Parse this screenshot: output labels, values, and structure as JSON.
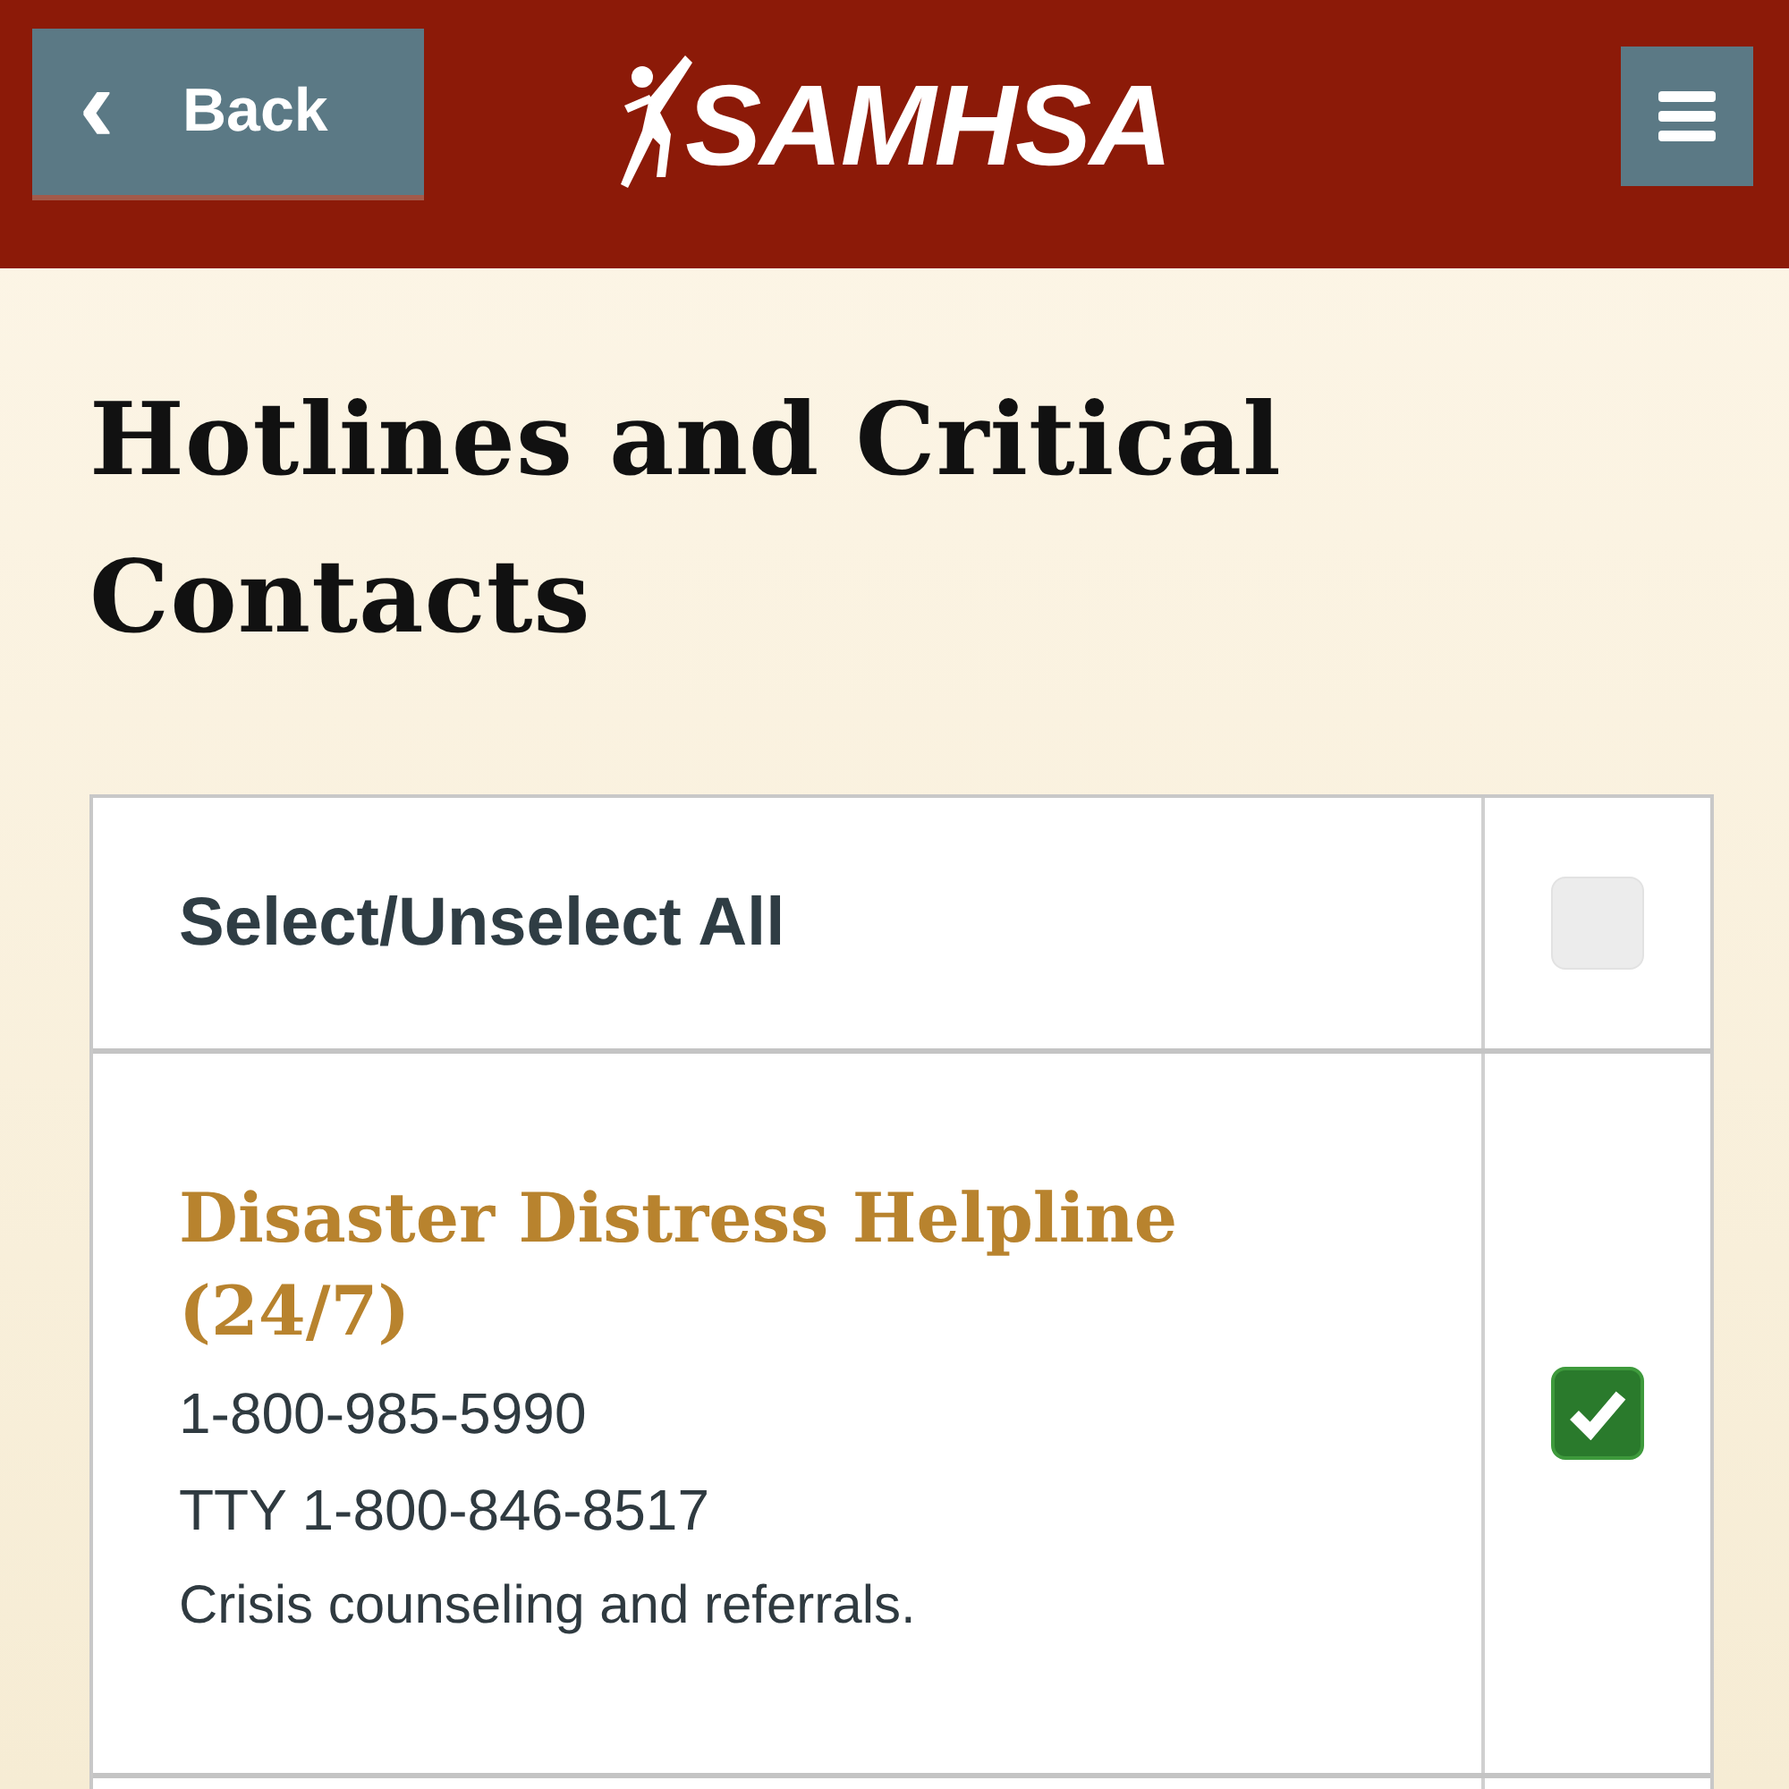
{
  "header": {
    "back_button": {
      "icon": "‹",
      "label": "Back"
    },
    "logo": "SAMHSA"
  },
  "title": "Hotlines and Critical Contacts",
  "select_all": {
    "label": "Select/Unselect All",
    "checked": false
  },
  "contacts": [
    {
      "name": "Disaster Distress Helpline (24/7)",
      "phone": "1-800-985-5990",
      "tty": "TTY 1-800-846-8517",
      "description": "Crisis counseling and referrals.",
      "checked": true
    }
  ]
}
